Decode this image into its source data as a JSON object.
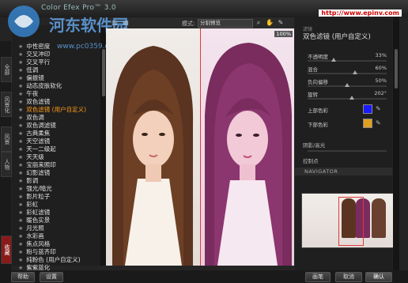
{
  "window": {
    "title": "Color Efex Pro™ 3.0",
    "url_badge": "http://www.epinv.com"
  },
  "watermark": {
    "text": "河东软件园",
    "url": "www.pc0359.cn"
  },
  "left_tabs": [
    {
      "label": "全部",
      "active": false
    },
    {
      "label": "风景化",
      "active": false
    },
    {
      "label": "风景",
      "active": false
    },
    {
      "label": "人物",
      "active": false
    },
    {
      "label": "收藏",
      "active": true
    }
  ],
  "filters": [
    "中性密度",
    "交叉冲印",
    "交叉平行",
    "低调",
    "偏振镜",
    "动态皮肤软化",
    "午夜",
    "双色滤镜",
    "双色滤镜 (用户自定义)",
    "双色调",
    "双色调滤镜",
    "古典柔焦",
    "天空滤镜",
    "天一二级起",
    "天天级",
    "宝丽来照印",
    "幻影滤镜",
    "影调",
    "强光/暗光",
    "影片粒子",
    "彩虹",
    "彩虹滤镜",
    "暖色实景",
    "月光照",
    "水彩画",
    "焦点风格",
    "粉与蓝齐印",
    "纯粉色 (用户自定义)",
    "紫紫蓝化",
    "老照片印",
    "黑白转换",
    "黑白透镜"
  ],
  "selected_filter_index": 8,
  "toolbar": {
    "mode_label": "模式:",
    "mode_value": "分割预览",
    "zoom": "100%"
  },
  "right_panel": {
    "small_label": "滤镜",
    "filter_title": "双色滤镜 (用户自定义)",
    "params": [
      {
        "label": "不透明度",
        "value": "33%",
        "fraction": 0.33
      },
      {
        "label": "混合",
        "value": "60%",
        "fraction": 0.6
      },
      {
        "label": "负向偏移",
        "value": "50%",
        "fraction": 0.5
      },
      {
        "label": "旋转",
        "value": "202°",
        "fraction": 0.56
      }
    ],
    "top_color_label": "上部色彩",
    "top_color": "#1a1aff",
    "bottom_color_label": "下部色彩",
    "bottom_color": "#e0a020",
    "section_shadow": "阴影/高光",
    "section_control": "控制点",
    "navigator": "NAVIGATOR"
  },
  "buttons": {
    "help": "帮助",
    "settings": "设置",
    "brush": "画笔",
    "cancel": "取消",
    "ok": "确认"
  }
}
